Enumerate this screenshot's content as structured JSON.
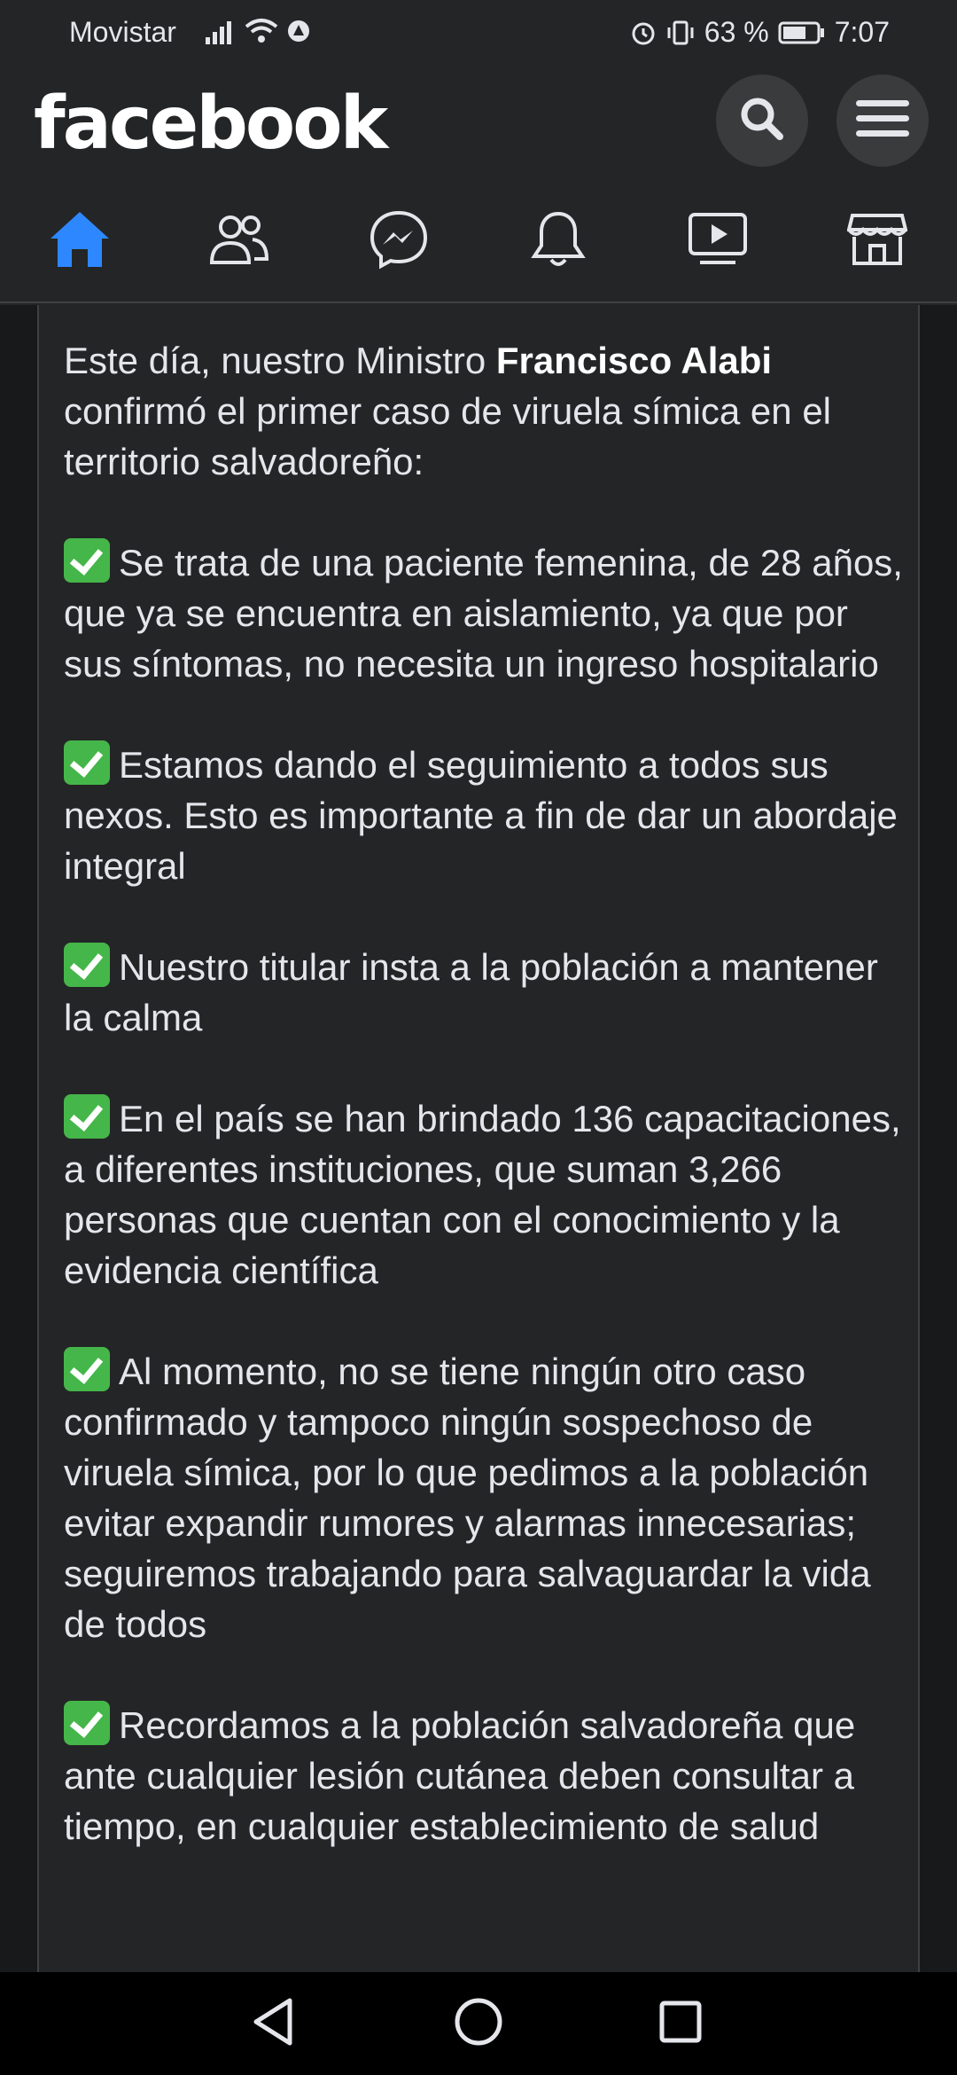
{
  "status_bar": {
    "carrier": "Movistar",
    "battery": "63 %",
    "time": "7:07"
  },
  "header": {
    "logo": "facebook",
    "accent": "#2d88ff"
  },
  "tabs": [
    {
      "name": "home",
      "icon": "home-icon",
      "active": true
    },
    {
      "name": "friends",
      "icon": "friends-icon",
      "active": false
    },
    {
      "name": "messenger",
      "icon": "messenger-icon",
      "active": false
    },
    {
      "name": "notifications",
      "icon": "bell-icon",
      "active": false
    },
    {
      "name": "watch",
      "icon": "video-icon",
      "active": false
    },
    {
      "name": "marketplace",
      "icon": "store-icon",
      "active": false
    }
  ],
  "post": {
    "intro_before": "Este día, nuestro Ministro ",
    "intro_bold": "Francisco Alabi",
    "intro_after": " confirmó el primer caso de viruela símica en el territorio salvadoreño:",
    "bullets": [
      "Se trata de una paciente femenina, de 28 años, que ya se encuentra en aislamiento, ya que por sus síntomas, no necesita un ingreso hospitalario",
      "Estamos dando el seguimiento a todos sus nexos. Esto es importante a fin de dar un abordaje integral",
      "Nuestro titular insta a la población a mantener la calma",
      "En el país se han brindado 136 capacitaciones, a diferentes instituciones, que suman 3,266 personas que cuentan con el conocimiento y la evidencia científica",
      "Al momento, no se tiene ningún otro caso confirmado y tampoco ningún sospechoso de viruela símica, por lo que pedimos a la población evitar expandir rumores y alarmas innecesarias; seguiremos trabajando para salvaguardar la vida de todos",
      "Recordamos a la población salvadoreña que ante cualquier lesión cutánea deben consultar a tiempo, en cualquier establecimiento de salud"
    ]
  },
  "navbar": {
    "buttons": [
      "back-icon",
      "home-circle-icon",
      "recents-icon"
    ]
  }
}
